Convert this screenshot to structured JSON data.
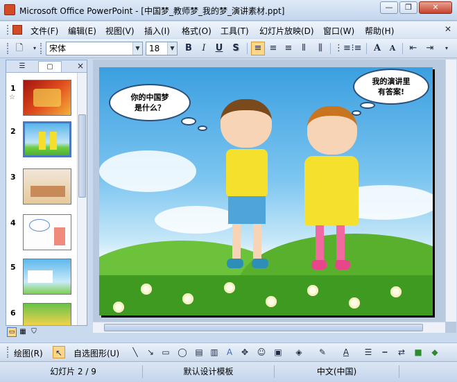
{
  "window": {
    "title": "Microsoft Office PowerPoint - [中国梦_教师梦_我的梦_演讲素材.ppt]",
    "minimize": "—",
    "restore": "❐",
    "close": "✕"
  },
  "menu": {
    "items": [
      "文件(F)",
      "编辑(E)",
      "视图(V)",
      "插入(I)",
      "格式(O)",
      "工具(T)",
      "幻灯片放映(D)",
      "窗口(W)",
      "帮助(H)"
    ],
    "close": "✕"
  },
  "toolbar": {
    "font_name": "宋体",
    "font_size": "18",
    "bold": "B",
    "italic": "I",
    "underline": "U",
    "shadow": "S",
    "grow_font": "A",
    "shrink_font": "A"
  },
  "left_pane": {
    "tab_outline_icon": "outline-icon",
    "tab_slides_icon": "slides-icon",
    "close": "×",
    "thumbnails": [
      {
        "num": "1",
        "star": "☆"
      },
      {
        "num": "2"
      },
      {
        "num": "3"
      },
      {
        "num": "4"
      },
      {
        "num": "5"
      },
      {
        "num": "6"
      }
    ]
  },
  "slide": {
    "bubble_left_lines": [
      "你的中国梦",
      "是什么？"
    ],
    "bubble_right_lines": [
      "我的演讲里",
      "有答案!"
    ]
  },
  "drawbar": {
    "draw_menu": "绘图(R)",
    "autoshapes_menu": "自选图形(U)"
  },
  "status": {
    "slide_position": "幻灯片 2 / 9",
    "design_template": "默认设计模板",
    "language": "中文(中国)"
  },
  "colors": {
    "accent": "#4a78c2",
    "title_icon": "#d24a26"
  }
}
